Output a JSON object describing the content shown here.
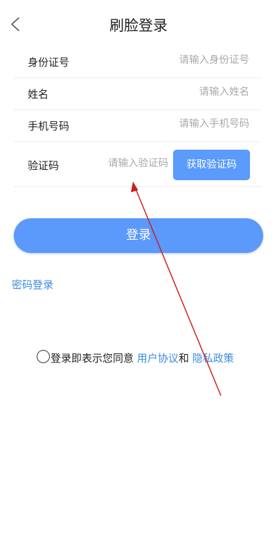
{
  "header": {
    "title": "刷脸登录",
    "back_icon": "chevron-left-icon"
  },
  "form": {
    "id_card": {
      "label": "身份证号",
      "placeholder": "请输入身份证号",
      "value": ""
    },
    "name": {
      "label": "姓名",
      "placeholder": "请输入姓名",
      "value": ""
    },
    "phone": {
      "label": "手机号码",
      "placeholder": "请输入手机号码",
      "value": ""
    },
    "code": {
      "label": "验证码",
      "placeholder": "请输入验证码",
      "value": "",
      "button_label": "获取验证码"
    }
  },
  "login_button": "登录",
  "password_login_link": "密码登录",
  "agreement": {
    "prefix": "登录即表示您同意",
    "user_agreement": "用户协议",
    "conjunction": "和",
    "privacy_policy": "隐私政策",
    "checked": false
  },
  "colors": {
    "primary": "#5b99fb",
    "link": "#3c8be0",
    "annotation": "#cc1f1f"
  }
}
